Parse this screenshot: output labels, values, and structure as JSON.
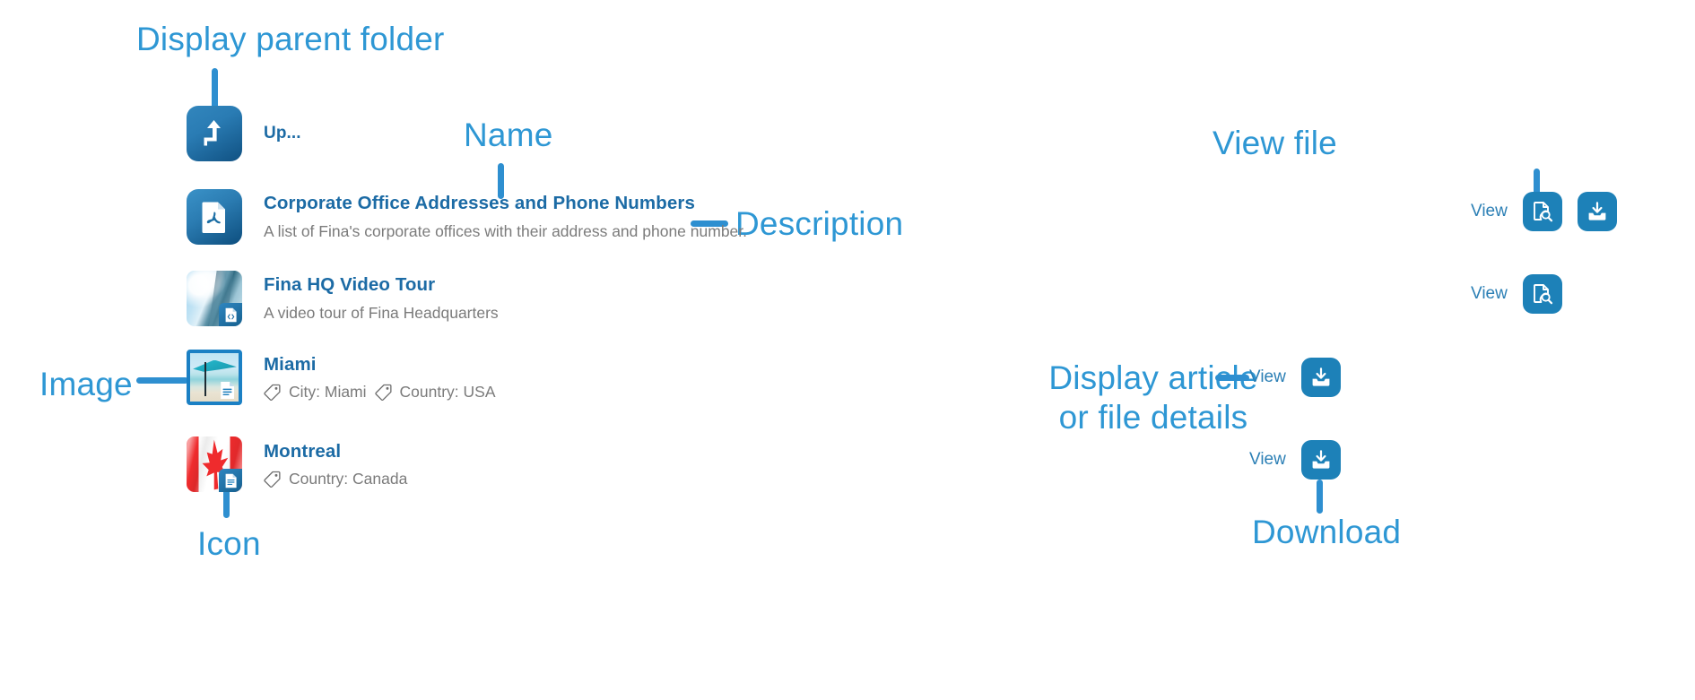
{
  "annotations": {
    "display_parent_folder": "Display parent folder",
    "name": "Name",
    "description": "Description",
    "view_file": "View file",
    "image": "Image",
    "icon": "Icon",
    "display_article_line1": "Display article",
    "display_article_line2": "or file details",
    "download": "Download"
  },
  "accent_colors": {
    "callout_blue": "#2e97d4",
    "connector_blue": "#2e8fd0",
    "title_blue": "#1c6ba5",
    "button_blue": "#1d81b8",
    "description_gray": "#7b7b7b"
  },
  "rows": [
    {
      "id": "up",
      "title": "Up...",
      "description": "",
      "icon_name": "level-up-icon",
      "thumbnail": "gradient-blue-square",
      "tags": [],
      "actions": []
    },
    {
      "id": "corporate-office-addresses",
      "title": "Corporate Office Addresses and Phone Numbers",
      "description": "A list of Fina's corporate offices with their address and phone number.",
      "icon_name": "pdf-file-icon",
      "thumbnail": "gradient-blue-square",
      "tags": [],
      "actions": [
        {
          "label": "View",
          "buttons": [
            "view-details-icon",
            "download-icon"
          ]
        }
      ]
    },
    {
      "id": "fina-hq-video-tour",
      "title": "Fina HQ Video Tour",
      "description": "A video tour of Fina Headquarters",
      "icon_name": "video-file-badge-icon",
      "thumbnail": "sky-building-photo",
      "tags": [],
      "actions": [
        {
          "label": "View",
          "buttons": [
            "view-details-icon"
          ]
        }
      ]
    },
    {
      "id": "miami",
      "title": "Miami",
      "description": "",
      "icon_name": "article-badge-icon",
      "thumbnail": "beach-umbrella-photo",
      "tags": [
        "City: Miami",
        "Country: USA"
      ],
      "actions": [
        {
          "label": "View",
          "buttons": [
            "download-icon"
          ]
        }
      ]
    },
    {
      "id": "montreal",
      "title": "Montreal",
      "description": "",
      "icon_name": "article-badge-icon",
      "thumbnail": "canada-flag-photo",
      "tags": [
        "Country: Canada"
      ],
      "actions": [
        {
          "label": "View",
          "buttons": [
            "download-icon"
          ]
        }
      ]
    }
  ],
  "action_labels": {
    "view": "View"
  }
}
